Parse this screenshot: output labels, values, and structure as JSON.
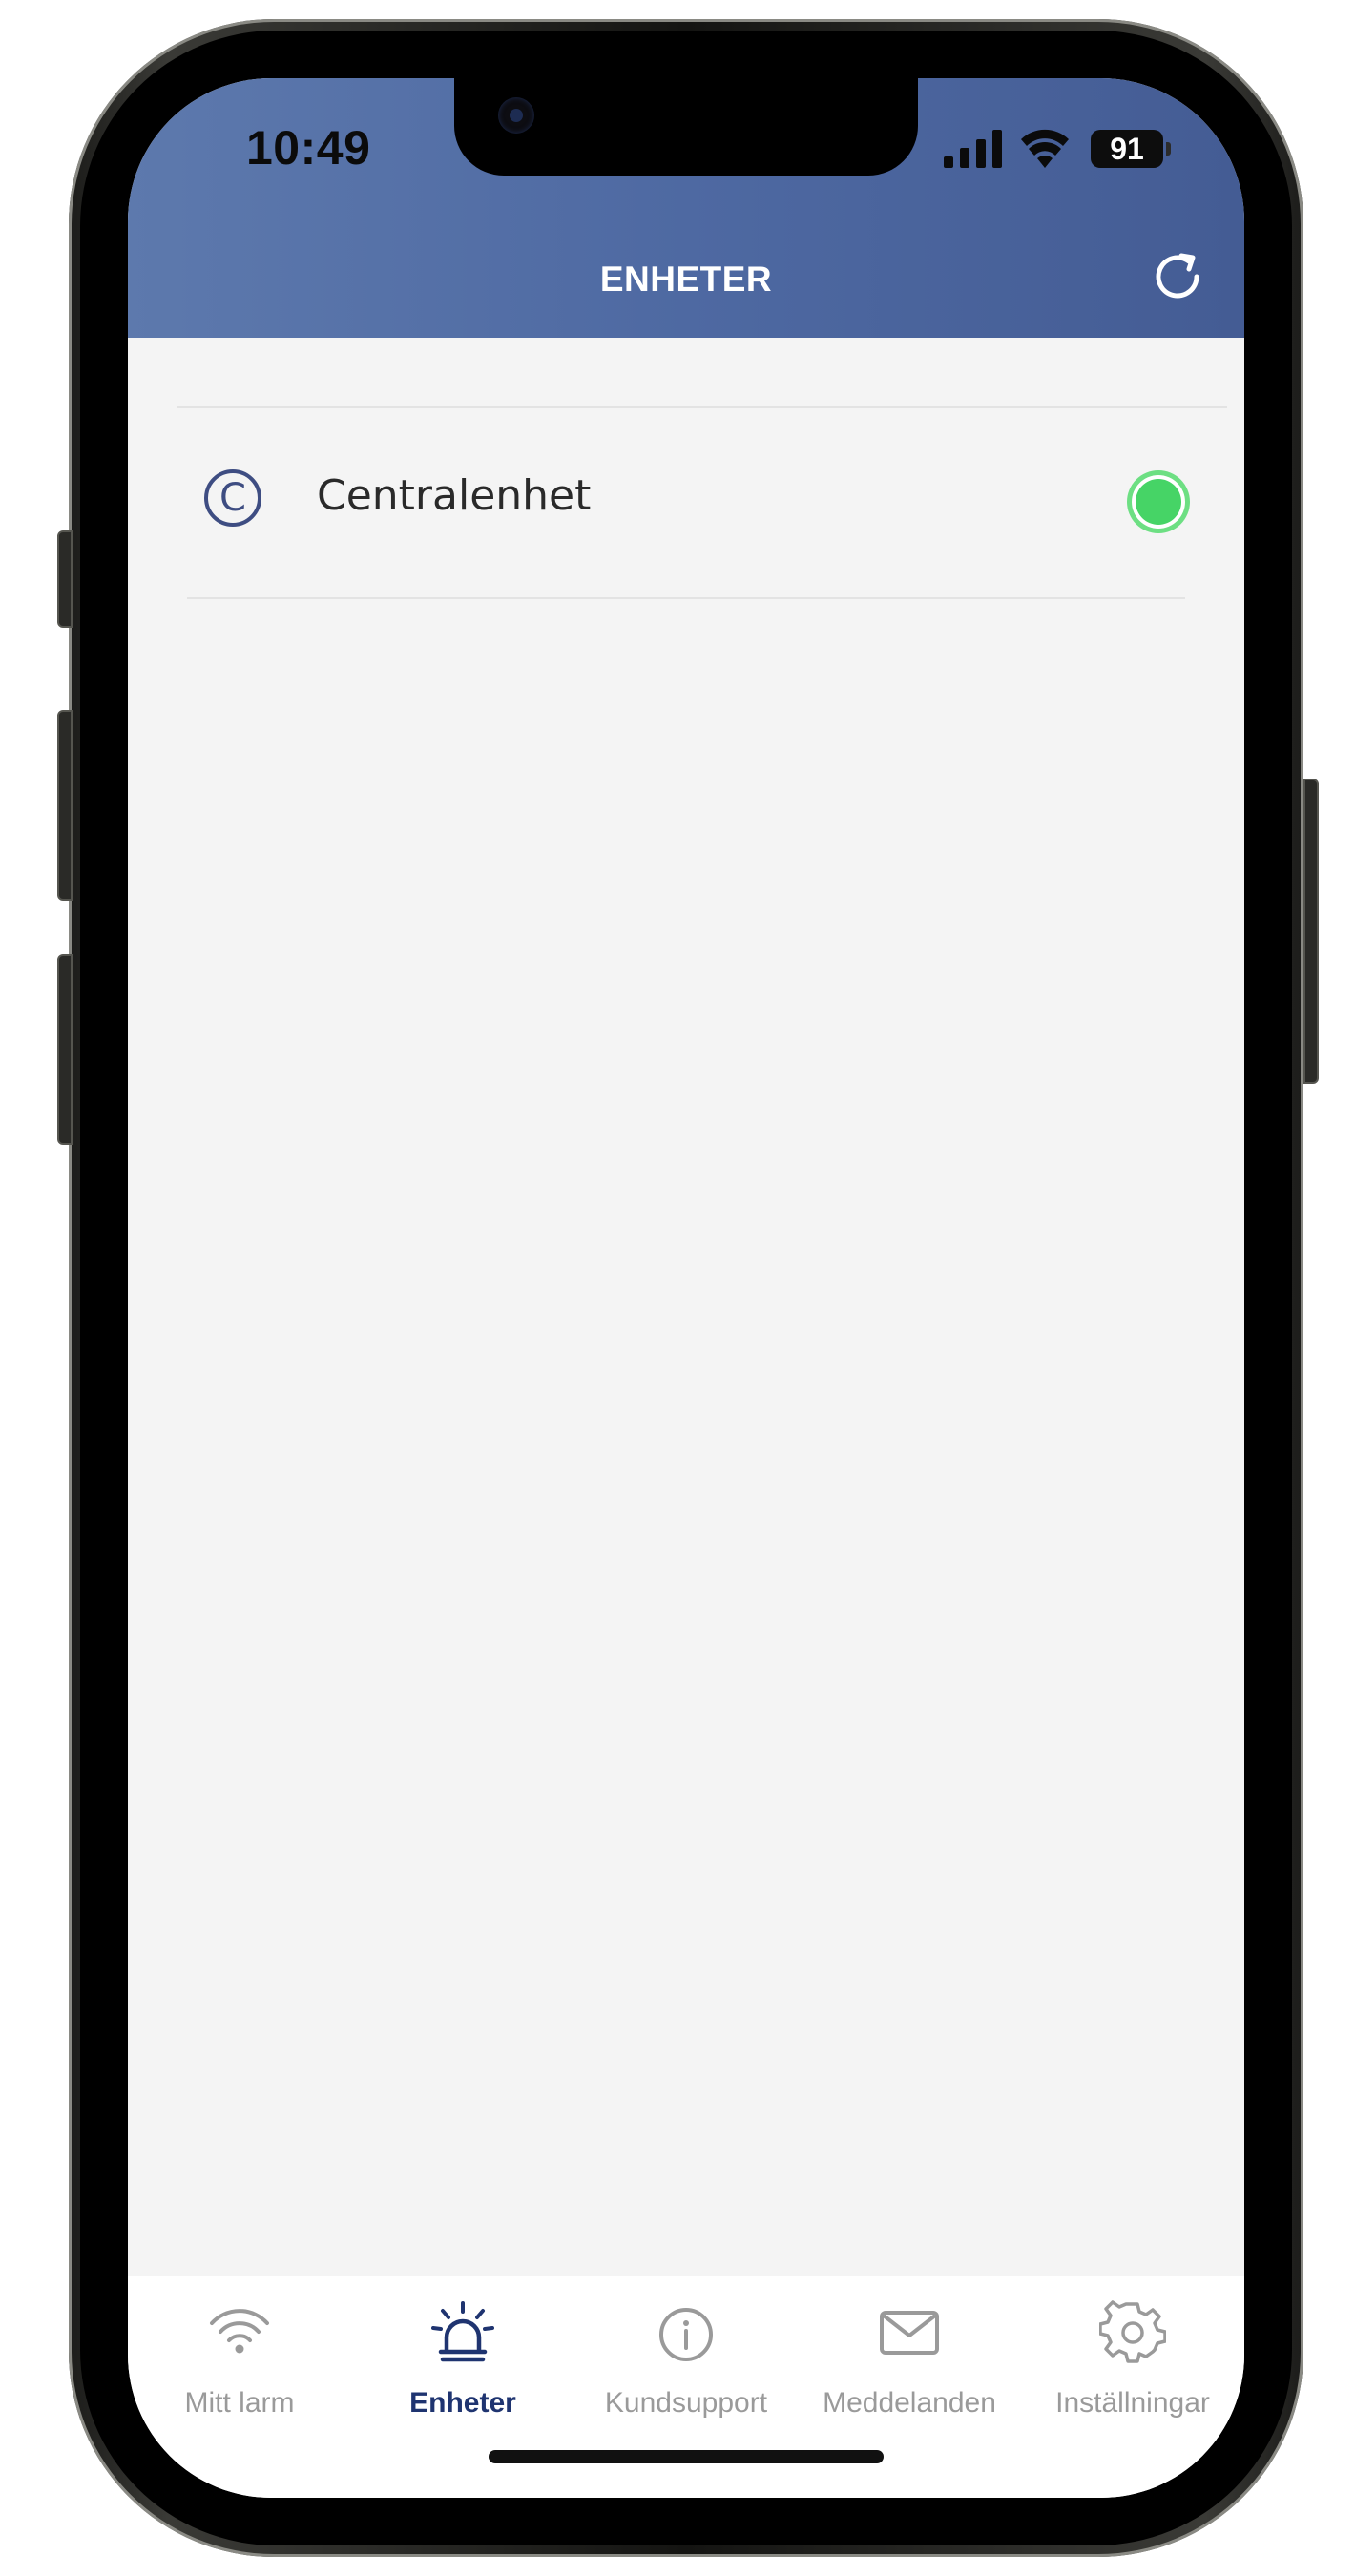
{
  "status_bar": {
    "time": "10:49",
    "battery": "91"
  },
  "header": {
    "title": "ENHETER"
  },
  "devices": [
    {
      "name": "Centralenhet",
      "icon_letter": "C",
      "status": "online"
    }
  ],
  "tabs": [
    {
      "label": "Mitt larm",
      "icon": "wifi-icon"
    },
    {
      "label": "Enheter",
      "icon": "siren-icon"
    },
    {
      "label": "Kundsupport",
      "icon": "info-icon"
    },
    {
      "label": "Meddelanden",
      "icon": "mail-icon"
    },
    {
      "label": "Inställningar",
      "icon": "gear-icon"
    }
  ],
  "active_tab": "Enheter",
  "colors": {
    "header": "#4e69a2",
    "active_tab": "#1f3470",
    "inactive_tab": "#9a9a9a",
    "online": "#46d466"
  }
}
